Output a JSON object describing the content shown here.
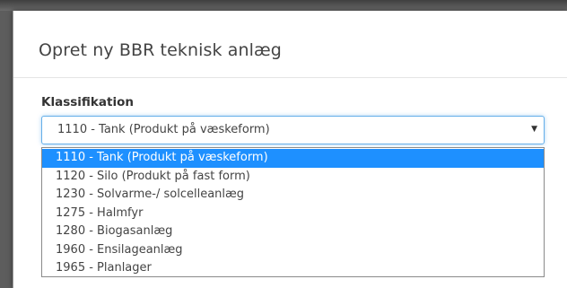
{
  "dialog": {
    "title": "Opret ny BBR teknisk anlæg",
    "field_label": "Klassifikation",
    "select": {
      "value": "1110 - Tank (Produkt på væskeform)",
      "caret_icon": "caret-down-icon"
    },
    "options": [
      "1110 - Tank (Produkt på væskeform)",
      "1120 - Silo (Produkt på fast form)",
      "1230 - Solvarme-/ solcelleanlæg",
      "1275 - Halmfyr",
      "1280 - Biogasanlæg",
      "1960 - Ensilageanlæg",
      "1965 - Planlager"
    ],
    "highlighted_option_index": 0,
    "colors": {
      "highlight": "#1e90ff",
      "focus_border": "#66afe9"
    }
  }
}
